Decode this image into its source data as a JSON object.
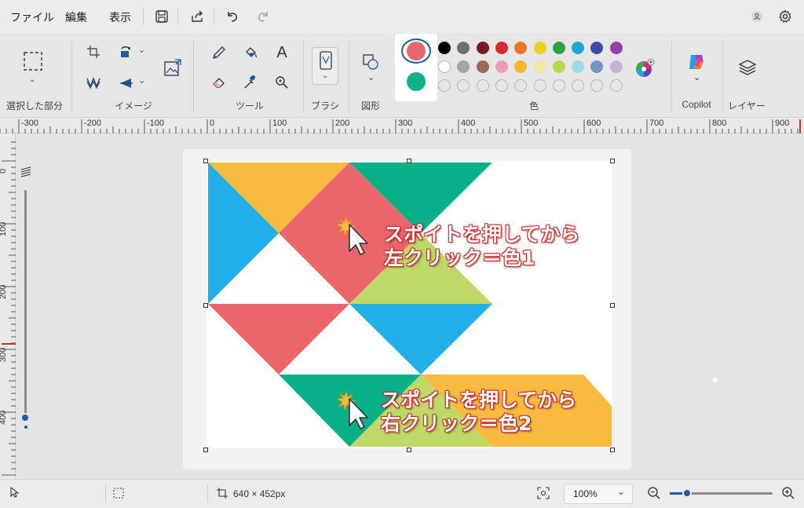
{
  "menu": {
    "file": "ファイル",
    "edit": "編集",
    "view": "表示"
  },
  "ribbon": {
    "groups": {
      "selection": "選択した部分",
      "image": "イメージ",
      "tools": "ツール",
      "brush": "ブラシ",
      "shapes": "図形",
      "colors": "色",
      "copilot": "Copilot",
      "layers": "レイヤー"
    },
    "tool_text_glyph": "A",
    "primary_color": "#e8676b",
    "secondary_color": "#0fb08a",
    "palette_row1": [
      "#000000",
      "#6e6e6e",
      "#7a1b25",
      "#d62a33",
      "#ee7428",
      "#e6d321",
      "#2aa24c",
      "#1fa6d6",
      "#3b4aa8",
      "#8e43a6"
    ],
    "palette_row2": [
      "#ffffff",
      "#a5a5a5",
      "#9a6a55",
      "#ec9db3",
      "#f3b92b",
      "#efe8a6",
      "#b9d84f",
      "#9ed9ea",
      "#7693c3",
      "#c3b3d9"
    ],
    "palette_row3_empty_count": 10
  },
  "rulers": {
    "horizontal": [
      "-300",
      "-200",
      "-100",
      "0",
      "100",
      "200",
      "300",
      "400",
      "500",
      "600",
      "700",
      "800",
      "900"
    ],
    "vertical": [
      "0",
      "100",
      "200",
      "300",
      "400"
    ]
  },
  "canvas": {
    "shape_colors": {
      "yellow": "#f9bb3f",
      "green": "#07b089",
      "blue": "#22aee6",
      "red": "#ea666b",
      "lime": "#bfd966"
    },
    "annotation1": {
      "line1": "スポイトを押してから",
      "line2": "左クリック＝色1"
    },
    "annotation2": {
      "line1": "スポイトを押してから",
      "line2": "右クリック＝色2"
    }
  },
  "status": {
    "dimensions": "640 × 452px",
    "zoom": "100%"
  }
}
